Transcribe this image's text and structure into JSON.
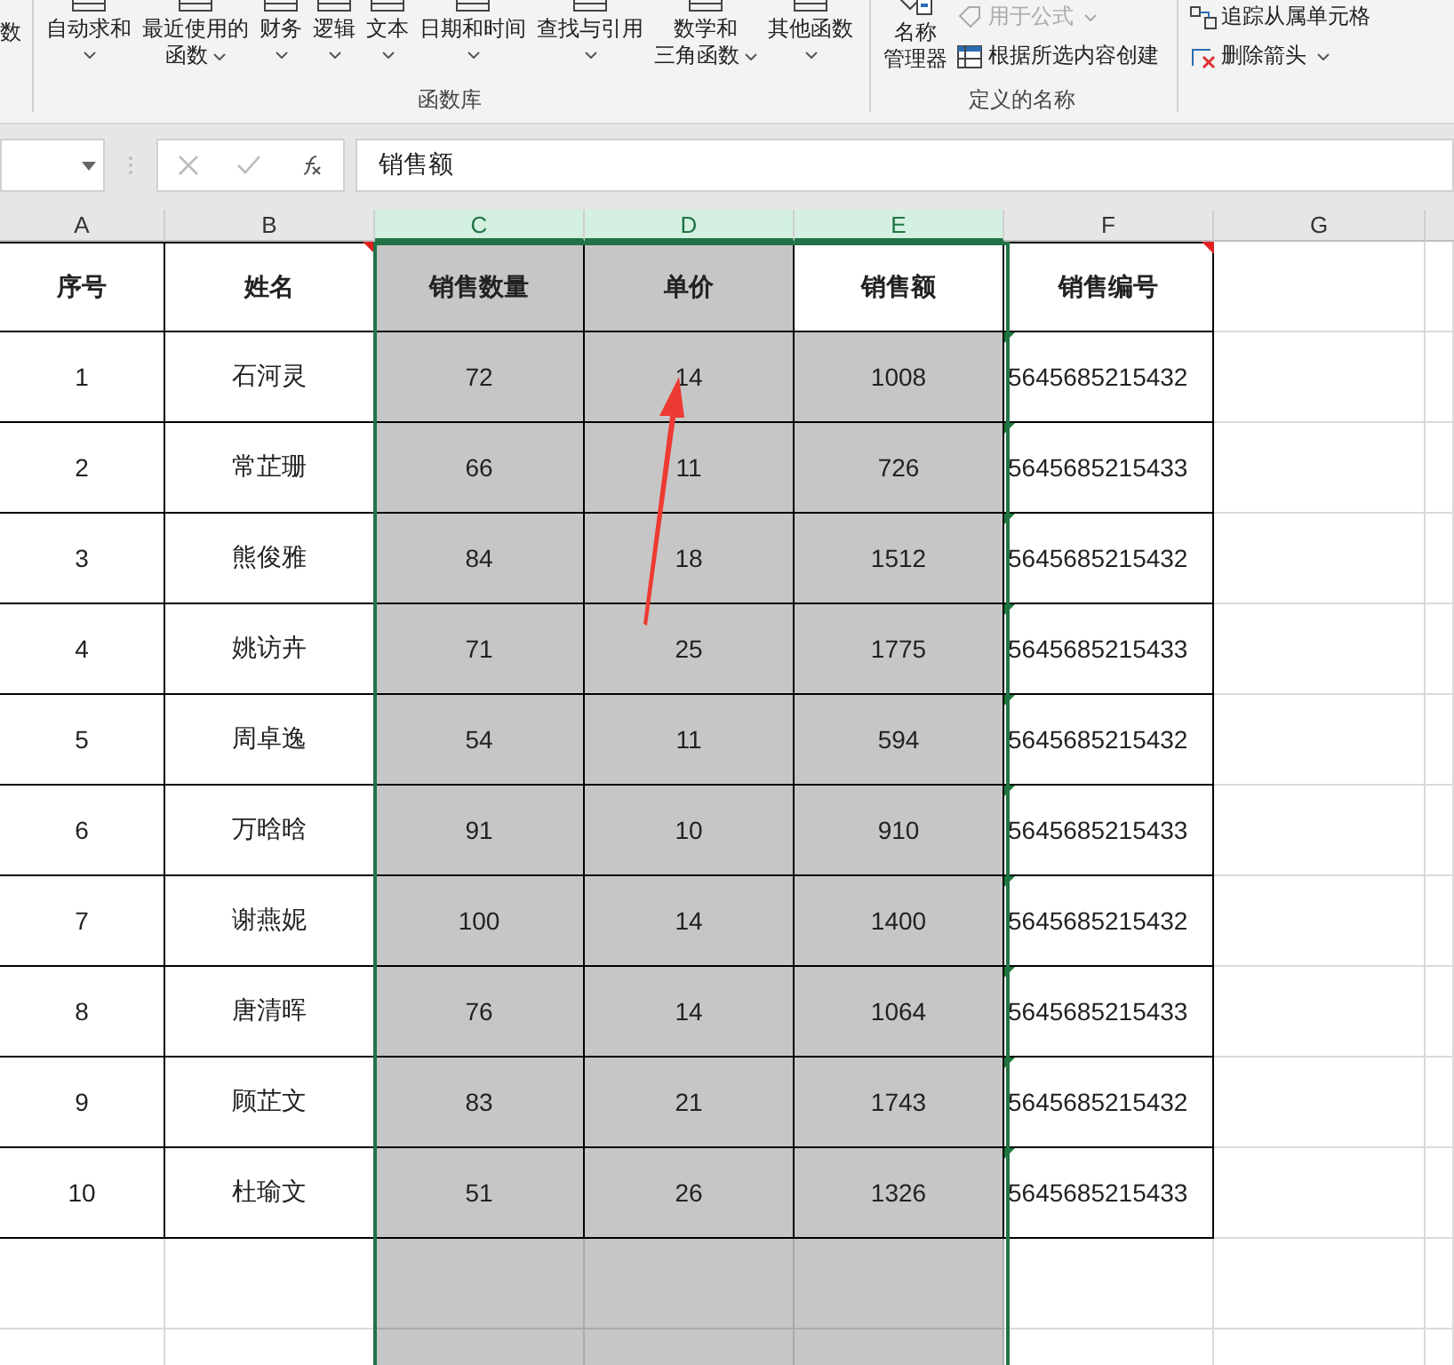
{
  "ribbon": {
    "cut_label": "数",
    "groups": [
      {
        "label": "函数库",
        "big_buttons": [
          {
            "lines": [
              "自动求和"
            ],
            "caret": true
          },
          {
            "lines": [
              "最近使用的",
              "函数"
            ],
            "caret": true
          },
          {
            "lines": [
              "财务"
            ],
            "caret": true
          },
          {
            "lines": [
              "逻辑"
            ],
            "caret": true
          },
          {
            "lines": [
              "文本"
            ],
            "caret": true
          },
          {
            "lines": [
              "日期和时间"
            ],
            "caret": true
          },
          {
            "lines": [
              "查找与引用"
            ],
            "caret": true
          },
          {
            "lines": [
              "数学和",
              "三角函数"
            ],
            "caret": true
          },
          {
            "lines": [
              "其他函数"
            ],
            "caret": true
          }
        ]
      },
      {
        "label": "定义的名称",
        "big_buttons": [
          {
            "lines": [
              "名称",
              "管理器"
            ],
            "caret": false
          }
        ],
        "small_buttons": [
          {
            "label": "用于公式",
            "kind": "tag",
            "disabled": true,
            "caret": true
          },
          {
            "label": "根据所选内容创建",
            "kind": "grid",
            "disabled": false,
            "caret": false
          }
        ]
      },
      {
        "small_buttons": [
          {
            "label": "追踪从属单元格",
            "kind": "trace",
            "disabled": false,
            "caret": false
          },
          {
            "label": "删除箭头",
            "kind": "remove",
            "disabled": false,
            "caret": true
          }
        ]
      }
    ]
  },
  "formula_bar": {
    "formula": "销售额"
  },
  "columns": [
    {
      "label": "A",
      "selected": false,
      "text_numbers": false
    },
    {
      "label": "B",
      "selected": false,
      "text_numbers": false
    },
    {
      "label": "C",
      "selected": true,
      "text_numbers": false
    },
    {
      "label": "D",
      "selected": true,
      "text_numbers": false
    },
    {
      "label": "E",
      "selected": true,
      "text_numbers": false
    },
    {
      "label": "F",
      "selected": false,
      "text_numbers": true
    },
    {
      "label": "G",
      "selected": false,
      "text_numbers": false
    }
  ],
  "header": [
    {
      "text": "序号",
      "comment": false,
      "selected": false
    },
    {
      "text": "姓名",
      "comment": true,
      "selected": false
    },
    {
      "text": "销售数量",
      "comment": false,
      "selected": true
    },
    {
      "text": "单价",
      "comment": false,
      "selected": true
    },
    {
      "text": "销售额",
      "comment": false,
      "selected": false
    },
    {
      "text": "销售编号",
      "comment": true,
      "selected": false
    }
  ],
  "rows": [
    [
      "1",
      "石河灵",
      "72",
      "14",
      "1008",
      "5645685215432"
    ],
    [
      "2",
      "常芷珊",
      "66",
      "11",
      "726",
      "5645685215433"
    ],
    [
      "3",
      "熊俊雅",
      "84",
      "18",
      "1512",
      "5645685215432"
    ],
    [
      "4",
      "姚访卉",
      "71",
      "25",
      "1775",
      "5645685215433"
    ],
    [
      "5",
      "周卓逸",
      "54",
      "11",
      "594",
      "5645685215432"
    ],
    [
      "6",
      "万晗晗",
      "91",
      "10",
      "910",
      "5645685215433"
    ],
    [
      "7",
      "谢燕妮",
      "100",
      "14",
      "1400",
      "5645685215432"
    ],
    [
      "8",
      "唐清晖",
      "76",
      "14",
      "1064",
      "5645685215433"
    ],
    [
      "9",
      "顾芷文",
      "83",
      "21",
      "1743",
      "5645685215432"
    ],
    [
      "10",
      "杜瑜文",
      "51",
      "26",
      "1326",
      "5645685215433"
    ]
  ],
  "annotation": {
    "kind": "arrow"
  }
}
